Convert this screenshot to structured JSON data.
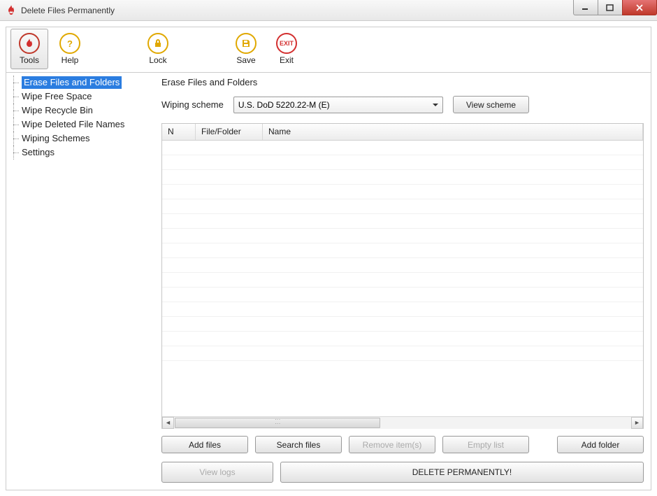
{
  "window": {
    "title": "Delete Files Permanently"
  },
  "toolbar": {
    "tools": "Tools",
    "help": "Help",
    "lock": "Lock",
    "save": "Save",
    "exit": "Exit",
    "exit_icon_text": "EXIT"
  },
  "sidebar": {
    "items": [
      "Erase Files and Folders",
      "Wipe Free Space",
      "Wipe Recycle Bin",
      "Wipe Deleted File Names",
      "Wiping Schemes",
      "Settings"
    ],
    "selected_index": 0
  },
  "main": {
    "title": "Erase Files and Folders",
    "wiping_label": "Wiping scheme",
    "wiping_value": "U.S. DoD 5220.22-M (E)",
    "view_scheme": "View scheme",
    "columns": {
      "n": "N",
      "file_folder": "File/Folder",
      "name": "Name"
    },
    "buttons": {
      "add_files": "Add files",
      "search_files": "Search files",
      "remove_items": "Remove item(s)",
      "empty_list": "Empty list",
      "add_folder": "Add folder",
      "view_logs": "View logs",
      "delete": "DELETE PERMANENTLY!"
    }
  }
}
